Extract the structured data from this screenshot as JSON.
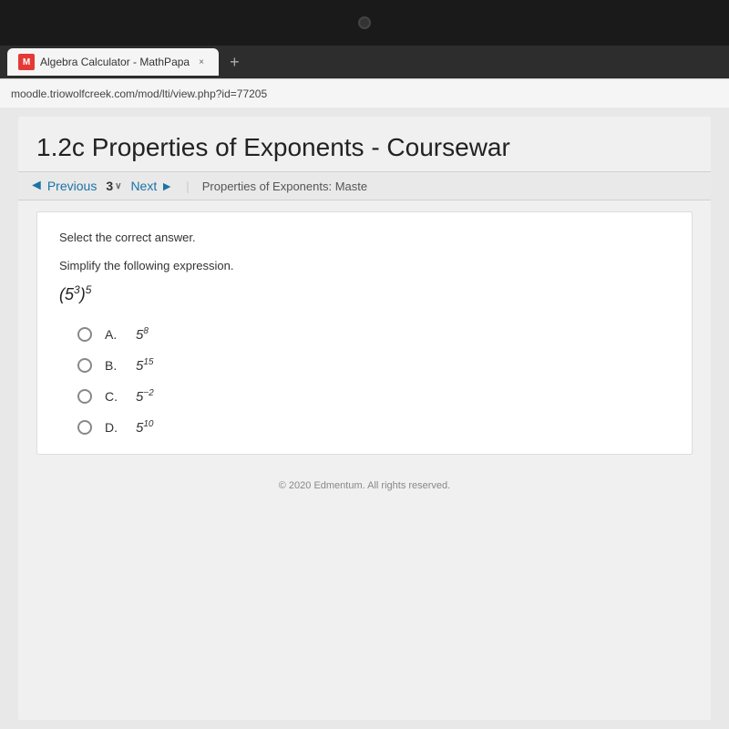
{
  "camera_bar": {},
  "browser": {
    "tab_label": "Algebra Calculator - MathPapa",
    "tab_close": "×",
    "tab_new": "+",
    "address": "moodle.triowolfcreek.com/mod/lti/view.php?id=77205"
  },
  "page": {
    "title": "1.2c Properties of Exponents - Coursewar",
    "nav": {
      "previous_label": "Previous",
      "number": "3",
      "dropdown_arrow": "∨",
      "next_label": "Next",
      "context": "Properties of Exponents: Maste"
    },
    "quiz": {
      "instruction": "Select the correct answer.",
      "question": "Simplify the following expression.",
      "expression_base": "(5",
      "expression_inner_exp": "3",
      "expression_outer_exp": "5",
      "expression_display": "(5³)⁵",
      "options": [
        {
          "id": "A",
          "base": "5",
          "exp": "8"
        },
        {
          "id": "B",
          "base": "5",
          "exp": "15"
        },
        {
          "id": "C",
          "base": "5",
          "exp": "−2"
        },
        {
          "id": "D",
          "base": "5",
          "exp": "10"
        }
      ],
      "footer": "© 2020 Edmentum. All rights reserved."
    }
  }
}
